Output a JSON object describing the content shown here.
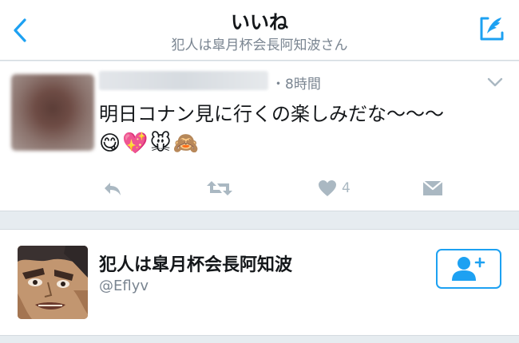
{
  "header": {
    "title": "いいね",
    "subtitle": "犯人は皐月杯会長阿知波さん",
    "back_icon": "chevron-left-icon",
    "compose_icon": "compose-tweet-icon"
  },
  "tweet": {
    "author_name": "",
    "time": "・8時間",
    "text": "明日コナン見に行くの楽しみだな〜〜〜",
    "emoji": "😋💖🐭🙈",
    "like_count": "4",
    "actions": [
      "reply-icon",
      "retweet-icon",
      "heart-icon",
      "dm-icon"
    ]
  },
  "user_card": {
    "name": "犯人は皐月杯会長阿知波",
    "handle": "@Eflyv",
    "follow_icon": "add-user-icon"
  },
  "colors": {
    "accent": "#1da1f2",
    "muted": "#aab8c2",
    "secondary_text": "#7a8591",
    "background": "#e6ecf0"
  }
}
